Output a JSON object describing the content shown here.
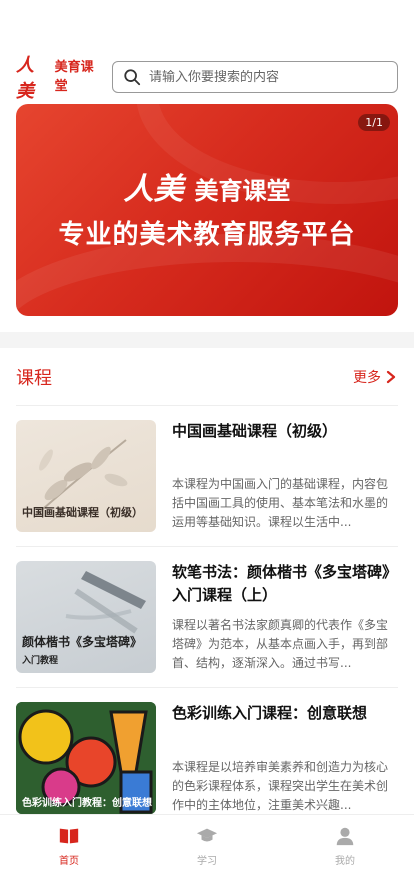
{
  "header": {
    "logo_mark": "人美",
    "logo_text": "美育课堂",
    "search_placeholder": "请输入你要搜索的内容"
  },
  "banner": {
    "counter": "1/1",
    "brand_mark": "人美",
    "brand_text": "美育课堂",
    "slogan": "专业的美术教育服务平台"
  },
  "courses_section": {
    "title": "课程",
    "more_label": "更多",
    "items": [
      {
        "title": "中国画基础课程（初级）",
        "description": "本课程为中国画入门的基础课程，内容包括中国画工具的使用、基本笔法和水墨的运用等基础知识。课程以生活中...",
        "thumb_caption": "中国画基础课程（初级）"
      },
      {
        "title": "软笔书法：颜体楷书《多宝塔碑》入门课程（上）",
        "description": "课程以著名书法家颜真卿的代表作《多宝塔碑》为范本，从基本点画入手，再到部首、结构，逐渐深入。通过书写...",
        "thumb_caption": "颜体楷书《多宝塔碑》",
        "thumb_subcaption": "入门教程"
      },
      {
        "title": "色彩训练入门课程：创意联想",
        "description": "本课程是以培养审美素养和创造力为核心的色彩课程体系，课程突出学生在美术创作中的主体地位，注重美术兴趣...",
        "thumb_caption": "色彩训练入门教程：创意联想"
      }
    ]
  },
  "tabbar": {
    "tabs": [
      {
        "label": "首页",
        "icon": "book-icon",
        "active": true
      },
      {
        "label": "学习",
        "icon": "graduation-cap-icon",
        "active": false
      },
      {
        "label": "我的",
        "icon": "user-icon",
        "active": false
      }
    ]
  },
  "colors": {
    "brand_red": "#d7261d",
    "inactive_gray": "#aaaaaa"
  }
}
